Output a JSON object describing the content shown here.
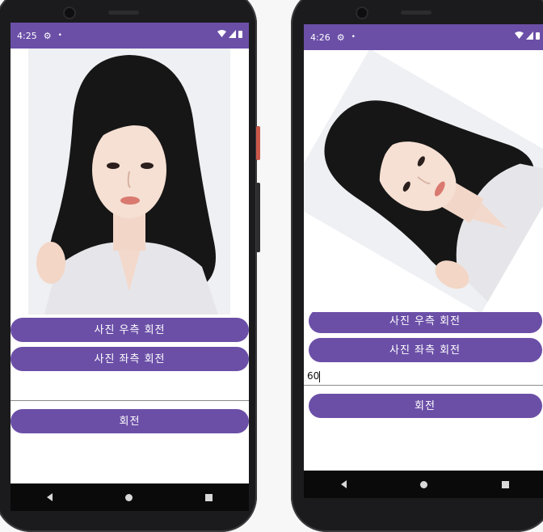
{
  "phone1": {
    "status": {
      "time": "4:25"
    },
    "buttons": {
      "rotate_right": "사진 우측 회전",
      "rotate_left": "사진 좌측 회전",
      "rotate": "회전"
    },
    "input": {
      "value": ""
    }
  },
  "phone2": {
    "status": {
      "time": "4:26"
    },
    "buttons": {
      "rotate_right": "사진 우측 회전",
      "rotate_left": "사진 좌측 회전",
      "rotate": "회전"
    },
    "input": {
      "value": "60"
    }
  },
  "icons": [
    "gear-icon",
    "notification-dot-icon",
    "wifi-icon",
    "signal-icon",
    "battery-icon",
    "back-icon",
    "home-icon",
    "recents-icon"
  ],
  "colors": {
    "accent": "#6b4fa7",
    "screen_bg": "#ffffff",
    "nav_bg": "#0a0a0a"
  }
}
